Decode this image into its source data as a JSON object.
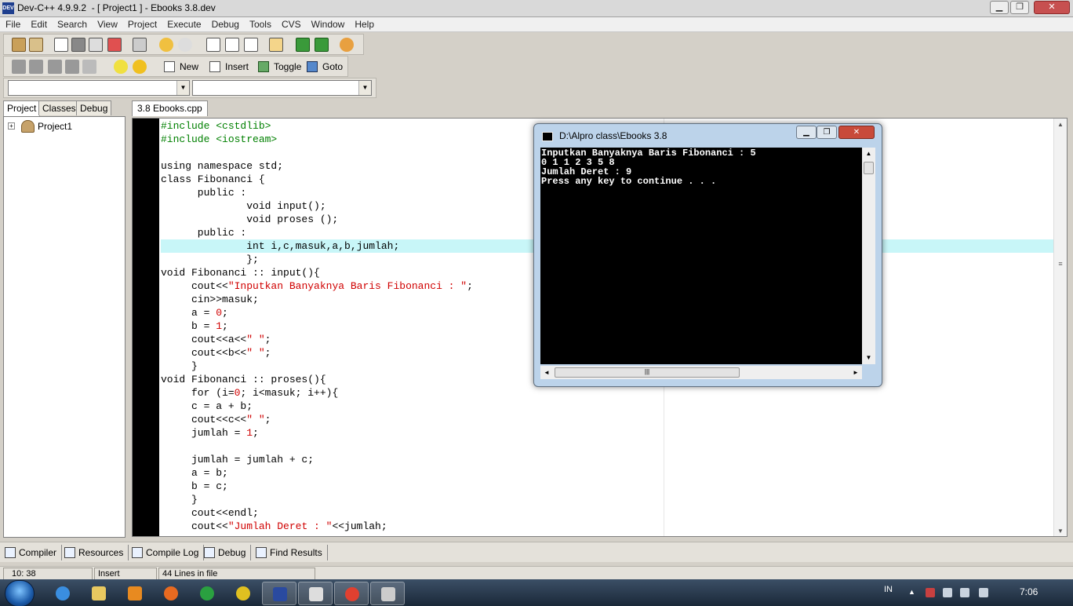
{
  "window": {
    "app_icon_text": "DEV",
    "title": "Dev-C++ 4.9.9.2  - [ Project1 ] - Ebooks 3.8.dev"
  },
  "menu": [
    "File",
    "Edit",
    "Search",
    "View",
    "Project",
    "Execute",
    "Debug",
    "Tools",
    "CVS",
    "Window",
    "Help"
  ],
  "toolbar2": {
    "new_label": "New",
    "insert_label": "Insert",
    "toggle_label": "Toggle",
    "goto_label": "Goto"
  },
  "left_tabs": [
    "Project",
    "Classes",
    "Debug"
  ],
  "project_tree": {
    "root": "Project1"
  },
  "editor_tab": "3.8 Ebooks.cpp",
  "code_lines": [
    "#include <cstdlib>",
    "#include <iostream>",
    "",
    "using namespace std;",
    "class Fibonanci {",
    "      public :",
    "              void input();",
    "              void proses ();",
    "      public :",
    "              int i,c,masuk,a,b,jumlah;",
    "              };",
    "void Fibonanci :: input(){",
    "     cout<<\"Inputkan Banyaknya Baris Fibonanci : \";",
    "     cin>>masuk;",
    "     a = 0;",
    "     b = 1;",
    "     cout<<a<<\" \";",
    "     cout<<b<<\" \";",
    "     }",
    "void Fibonanci :: proses(){",
    "     for (i=0; i<masuk; i++){",
    "     c = a + b;",
    "     cout<<c<<\" \";",
    "     jumlah = 1;",
    "",
    "     jumlah = jumlah + c;",
    "     a = b;",
    "     b = c;",
    "     }",
    "     cout<<endl;",
    "     cout<<\"Jumlah Deret : \"<<jumlah;"
  ],
  "highlighted_line": 9,
  "console": {
    "title": "D:\\Alpro class\\Ebooks 3.8",
    "lines": [
      "Inputkan Banyaknya Baris Fibonanci : 5",
      "0 1 1 2 3 5 8",
      "Jumlah Deret : 9",
      "Press any key to continue . . ."
    ]
  },
  "bottom_tabs": [
    "Compiler",
    "Resources",
    "Compile Log",
    "Debug",
    "Find Results"
  ],
  "status": {
    "position": "10: 38",
    "mode": "Insert",
    "lines": "44 Lines in file"
  },
  "taskbar": {
    "language": "IN",
    "clock": "7:06"
  },
  "colors": {
    "string": "#d00000",
    "preprocessor": "#008000",
    "highlight": "#c8f6f8"
  }
}
